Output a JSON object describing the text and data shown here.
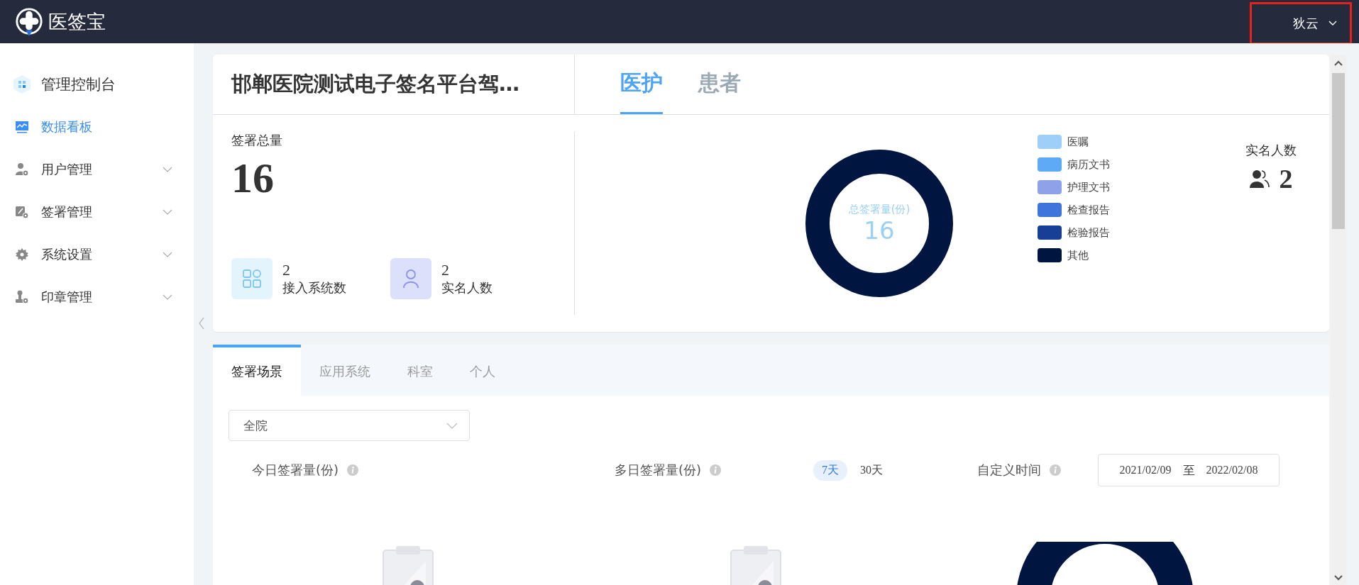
{
  "header": {
    "logo_text": "医签宝",
    "user": "狄云"
  },
  "sidebar": {
    "items": [
      {
        "label": "管理控制台",
        "kind": "console",
        "selected": false,
        "expandable": false
      },
      {
        "label": "数据看板",
        "kind": "dashboard",
        "selected": true,
        "expandable": false
      },
      {
        "label": "用户管理",
        "kind": "user",
        "selected": false,
        "expandable": true
      },
      {
        "label": "签署管理",
        "kind": "sign",
        "selected": false,
        "expandable": true
      },
      {
        "label": "系统设置",
        "kind": "settings",
        "selected": false,
        "expandable": true
      },
      {
        "label": "印章管理",
        "kind": "seal",
        "selected": false,
        "expandable": true
      }
    ]
  },
  "overview": {
    "title": "邯郸医院测试电子签名平台驾…",
    "tabs": [
      {
        "label": "医护",
        "selected": true
      },
      {
        "label": "患者",
        "selected": false
      }
    ],
    "total_label": "签署总量",
    "total_value": "16",
    "stats": [
      {
        "kind": "systems",
        "value": "2",
        "label": "接入系统数"
      },
      {
        "kind": "people",
        "value": "2",
        "label": "实名人数"
      }
    ],
    "donut": {
      "center_label": "总签署量(份)",
      "center_value": "16",
      "legend": [
        {
          "label": "医嘱",
          "color": "#9dcff9"
        },
        {
          "label": "病历文书",
          "color": "#5eaaf7"
        },
        {
          "label": "护理文书",
          "color": "#8fa2e9"
        },
        {
          "label": "检查报告",
          "color": "#3f74dc"
        },
        {
          "label": "检验报告",
          "color": "#173f95"
        },
        {
          "label": "其他",
          "color": "#001540"
        }
      ]
    },
    "realname": {
      "label": "实名人数",
      "value": "2"
    }
  },
  "detail": {
    "tabs": [
      {
        "label": "签署场景",
        "selected": true
      },
      {
        "label": "应用系统",
        "selected": false
      },
      {
        "label": "科室",
        "selected": false
      },
      {
        "label": "个人",
        "selected": false
      }
    ],
    "scope_select": {
      "value": "全院"
    },
    "today": {
      "label": "今日签署量(份)"
    },
    "multi": {
      "label": "多日签署量(份)",
      "ranges": [
        {
          "label": "7天",
          "selected": true
        },
        {
          "label": "30天",
          "selected": false
        }
      ]
    },
    "custom": {
      "label": "自定义时间",
      "start": "2021/02/09",
      "separator": "至",
      "end": "2022/02/08"
    }
  }
}
